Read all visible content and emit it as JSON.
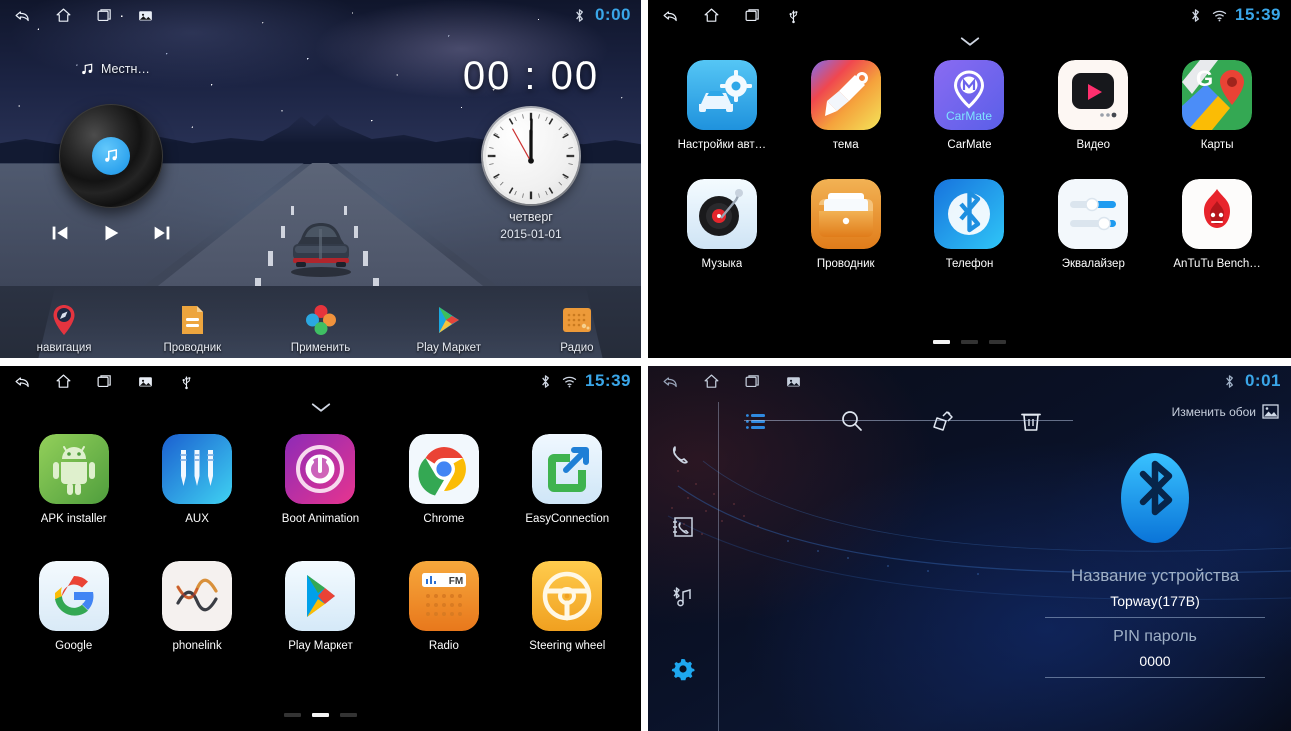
{
  "panels": {
    "home": {
      "name": "car-head-unit-home-screen",
      "statusbar": {
        "nav": [
          "back-icon",
          "home-icon",
          "recents-icon",
          "screenshot-icon"
        ],
        "indicators": [
          "bluetooth-icon"
        ],
        "clock": "0:00"
      },
      "now_playing": {
        "label": "Местн…",
        "icon": "music-note-icon"
      },
      "media": {
        "prev_label": "prev-track",
        "play_label": "play",
        "next_label": "next-track"
      },
      "clock_widget": {
        "time": "00 : 00",
        "hours": "00",
        "minutes": "00",
        "weekday": "четверг",
        "date": "2015-01-01"
      },
      "dock": [
        {
          "label": "навигация",
          "icon": "navigation-pin-icon"
        },
        {
          "label": "Проводник",
          "icon": "file-manager-icon"
        },
        {
          "label": "Применить",
          "icon": "apply-clover-icon"
        },
        {
          "label": "Play Маркет",
          "icon": "play-store-icon"
        },
        {
          "label": "Радио",
          "icon": "radio-icon"
        }
      ]
    },
    "apps_page1": {
      "name": "app-drawer-page-1",
      "statusbar": {
        "nav": [
          "back-icon",
          "home-icon",
          "recents-icon",
          "usb-icon"
        ],
        "indicators": [
          "bluetooth-icon",
          "wifi-icon"
        ],
        "clock": "15:39"
      },
      "rows": [
        [
          {
            "label": "Настройки авт…",
            "icon": "car-settings-icon"
          },
          {
            "label": "тема",
            "icon": "theme-brush-icon"
          },
          {
            "label": "CarMate",
            "icon": "carmate-icon"
          },
          {
            "label": "Видео",
            "icon": "video-player-icon"
          },
          {
            "label": "Карты",
            "icon": "google-maps-icon"
          }
        ],
        [
          {
            "label": "Музыка",
            "icon": "music-turntable-icon"
          },
          {
            "label": "Проводник",
            "icon": "file-explorer-icon"
          },
          {
            "label": "Телефон",
            "icon": "bluetooth-phone-icon"
          },
          {
            "label": "Эквалайзер",
            "icon": "equalizer-icon"
          },
          {
            "label": "AnTuTu Bench…",
            "icon": "antutu-icon"
          }
        ]
      ],
      "pager": {
        "count": 3,
        "active": 0
      }
    },
    "apps_page2": {
      "name": "app-drawer-page-2",
      "statusbar": {
        "nav": [
          "back-icon",
          "home-icon",
          "recents-icon",
          "screenshot-icon",
          "usb-icon"
        ],
        "indicators": [
          "bluetooth-icon",
          "wifi-icon"
        ],
        "clock": "15:39"
      },
      "rows": [
        [
          {
            "label": "APK installer",
            "icon": "android-robot-icon"
          },
          {
            "label": "AUX",
            "icon": "aux-jack-icon"
          },
          {
            "label": "Boot Animation",
            "icon": "power-boot-icon"
          },
          {
            "label": "Chrome",
            "icon": "chrome-icon"
          },
          {
            "label": "EasyConnection",
            "icon": "easyconnection-icon"
          }
        ],
        [
          {
            "label": "Google",
            "icon": "google-g-icon"
          },
          {
            "label": "phonelink",
            "icon": "phonelink-icon"
          },
          {
            "label": "Play Маркет",
            "icon": "play-store-icon"
          },
          {
            "label": "Radio",
            "icon": "fm-radio-icon"
          },
          {
            "label": "Steering wheel",
            "icon": "steering-wheel-icon"
          }
        ]
      ],
      "pager": {
        "count": 3,
        "active": 1
      }
    },
    "bluetooth": {
      "name": "bluetooth-settings-screen",
      "statusbar": {
        "nav": [
          "back-icon",
          "home-icon",
          "recents-icon",
          "screenshot-icon"
        ],
        "indicators": [
          "bluetooth-icon"
        ],
        "clock": "0:01"
      },
      "sidebar": [
        {
          "icon": "phone-handset-icon",
          "active": false
        },
        {
          "icon": "contacts-book-icon",
          "active": false
        },
        {
          "icon": "bluetooth-music-icon",
          "active": false
        },
        {
          "icon": "gear-icon",
          "active": true
        }
      ],
      "toolbar": [
        {
          "icon": "list-icon",
          "active": true
        },
        {
          "icon": "search-icon",
          "active": false
        },
        {
          "icon": "edit-pen-icon",
          "active": false
        },
        {
          "icon": "trash-icon",
          "active": false
        }
      ],
      "wallpaper_action": {
        "label": "Изменить обои",
        "icon": "image-icon"
      },
      "fields": [
        {
          "label": "Название устройства",
          "value": "Topway(177B)"
        },
        {
          "label": "PIN пароль",
          "value": "0000"
        }
      ]
    }
  },
  "colors": {
    "accent_blue": "#3aa6e8",
    "bt_blue": "#1ea8f0",
    "status_clock": "#3aa6e8"
  }
}
